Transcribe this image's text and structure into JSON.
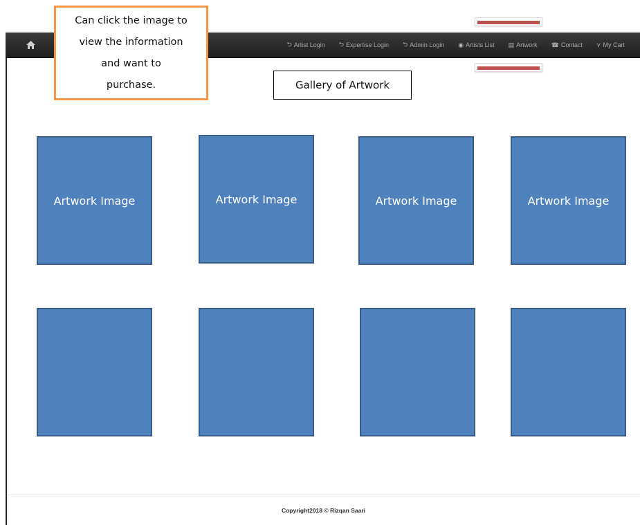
{
  "annotation": {
    "callout_lines": [
      "Can click the image to",
      "view the information",
      "and want to",
      "purchase."
    ]
  },
  "navbar": {
    "home_icon": "home-icon",
    "items": [
      {
        "label": "Artist Login",
        "icon": "⮌"
      },
      {
        "label": "Expertise Login",
        "icon": "⮌"
      },
      {
        "label": "Admin Login",
        "icon": "⮌"
      },
      {
        "label": "Artists List",
        "icon": "◉"
      },
      {
        "label": "Artwork",
        "icon": "▤"
      },
      {
        "label": "Contact",
        "icon": "☎"
      },
      {
        "label": "My Cart",
        "icon": "⋎"
      }
    ]
  },
  "gallery": {
    "title": "Gallery of Artwork",
    "row1": [
      "Artwork Image",
      "Artwork Image",
      "Artwork Image",
      "Artwork Image"
    ],
    "row2": [
      "",
      "",
      "",
      ""
    ]
  },
  "footer": {
    "copyright": "Copyright2018 © Rizqan Saari"
  },
  "colors": {
    "tile_fill": "#4f81bd",
    "tile_border": "#385d8a",
    "callout_border": "#f79646",
    "highlight_bar": "#c0504d",
    "navbar_bg": "#2b2b2b"
  }
}
